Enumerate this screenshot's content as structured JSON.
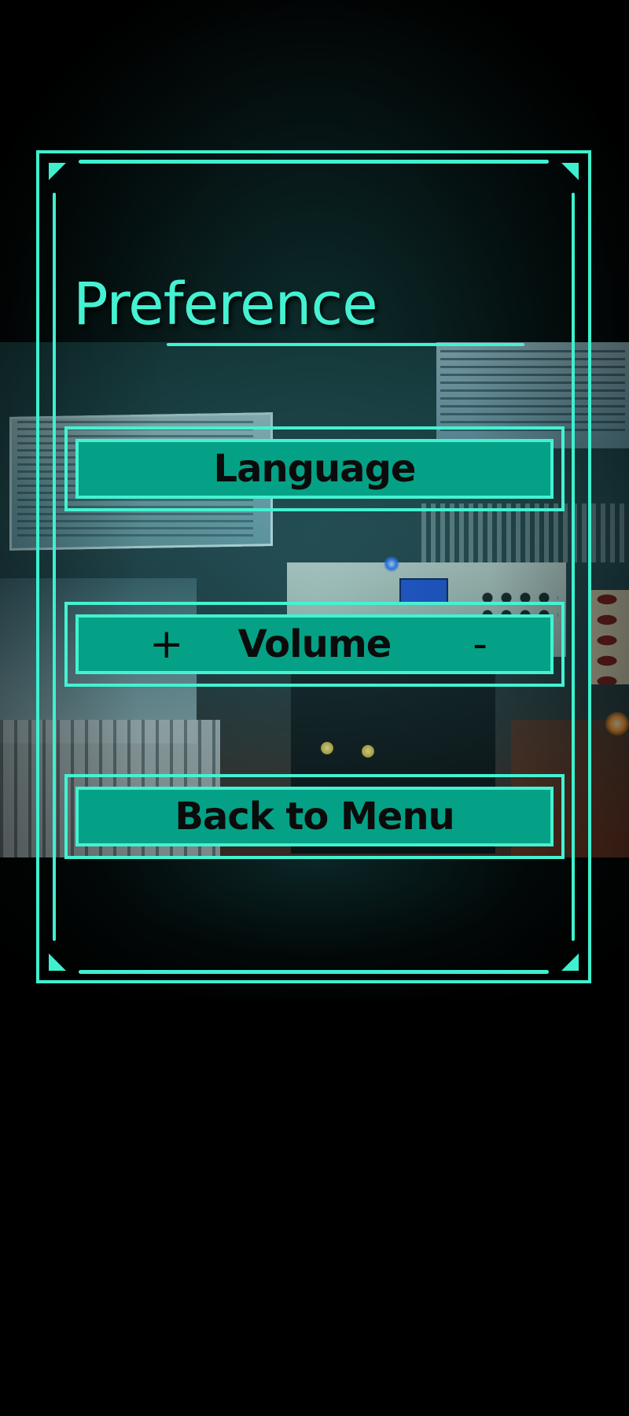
{
  "screen": {
    "title": "Preference"
  },
  "menu": {
    "language_label": "Language",
    "volume_label": "Volume",
    "volume_increase": "+",
    "volume_decrease": "-",
    "back_label": "Back to Menu"
  },
  "colors": {
    "accent": "#44f2d2",
    "button_fill": "#05a186",
    "button_text": "#0b0b0b",
    "background": "#000000"
  },
  "icons": {
    "volume_increase": "plus-icon",
    "volume_decrease": "minus-icon"
  }
}
